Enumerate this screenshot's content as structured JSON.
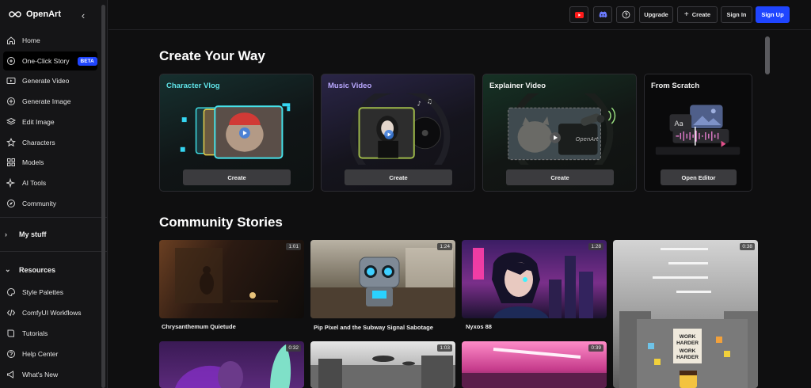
{
  "brand": {
    "name": "OpenArt"
  },
  "sidebar": {
    "items": [
      {
        "label": "Home",
        "icon": "home-icon"
      },
      {
        "label": "One-Click Story",
        "icon": "story-icon",
        "badge": "BETA"
      },
      {
        "label": "Generate Video",
        "icon": "video-icon"
      },
      {
        "label": "Generate Image",
        "icon": "plus-circle-icon"
      },
      {
        "label": "Edit Image",
        "icon": "layers-icon"
      },
      {
        "label": "Characters",
        "icon": "star-icon"
      },
      {
        "label": "Models",
        "icon": "grid-icon"
      },
      {
        "label": "AI Tools",
        "icon": "sparkle-icon"
      },
      {
        "label": "Community",
        "icon": "compass-icon"
      }
    ],
    "my_stuff": "My stuff",
    "resources": "Resources",
    "resource_items": [
      {
        "label": "Style Palettes",
        "icon": "palette-icon"
      },
      {
        "label": "ComfyUI Workflows",
        "icon": "code-icon"
      },
      {
        "label": "Tutorials",
        "icon": "book-icon"
      },
      {
        "label": "Help Center",
        "icon": "help-icon"
      },
      {
        "label": "What's New",
        "icon": "megaphone-icon"
      }
    ]
  },
  "topbar": {
    "upgrade": "Upgrade",
    "create": "Create",
    "sign_in": "Sign In",
    "sign_up": "Sign Up"
  },
  "create_section": {
    "title": "Create Your Way",
    "cards": [
      {
        "title": "Character Vlog",
        "button": "Create",
        "title_color": "#5fe3e8"
      },
      {
        "title": "Music Video",
        "button": "Create",
        "title_color": "#b9a8ff"
      },
      {
        "title": "Explainer Video",
        "button": "Create",
        "title_color": "#f2f2f2"
      },
      {
        "title": "From Scratch",
        "button": "Open Editor",
        "title_color": "#f2f2f2"
      }
    ]
  },
  "community": {
    "title": "Community Stories",
    "stories": [
      {
        "title": "Chrysanthemum Quietude",
        "duration": "1:01"
      },
      {
        "title": "Pip Pixel and the Subway Signal Sabotage",
        "duration": "1:24"
      },
      {
        "title": "Nyxos 88",
        "duration": "1:28"
      },
      {
        "title": "",
        "duration": "0:38"
      },
      {
        "title": "",
        "duration": "0:32"
      },
      {
        "title": "",
        "duration": "1:03"
      },
      {
        "title": "",
        "duration": "0:39"
      }
    ],
    "poster_text": [
      "WORK",
      "HARDER",
      "WORK",
      "HARDER"
    ]
  },
  "colors": {
    "accent": "#1f45ff",
    "background": "#0f0f10",
    "sidebar": "#151517"
  }
}
